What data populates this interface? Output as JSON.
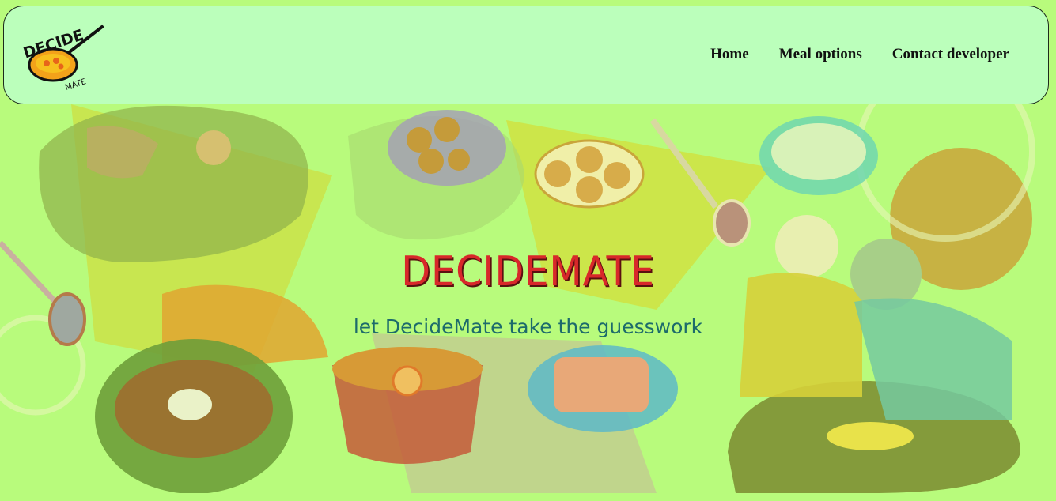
{
  "navbar": {
    "logo_text": "DECIDE",
    "logo_subtext": "MATE",
    "links": [
      "Home",
      "Meal options",
      "Contact developer"
    ]
  },
  "hero": {
    "title": "DECIDEMATE",
    "subtitle": "let DecideMate take the guesswork"
  },
  "colors": {
    "page_background": "#b8fb7c",
    "navbar_background": "#bbffbb",
    "title": "#d8282a",
    "subtitle": "#1d6b6b"
  }
}
